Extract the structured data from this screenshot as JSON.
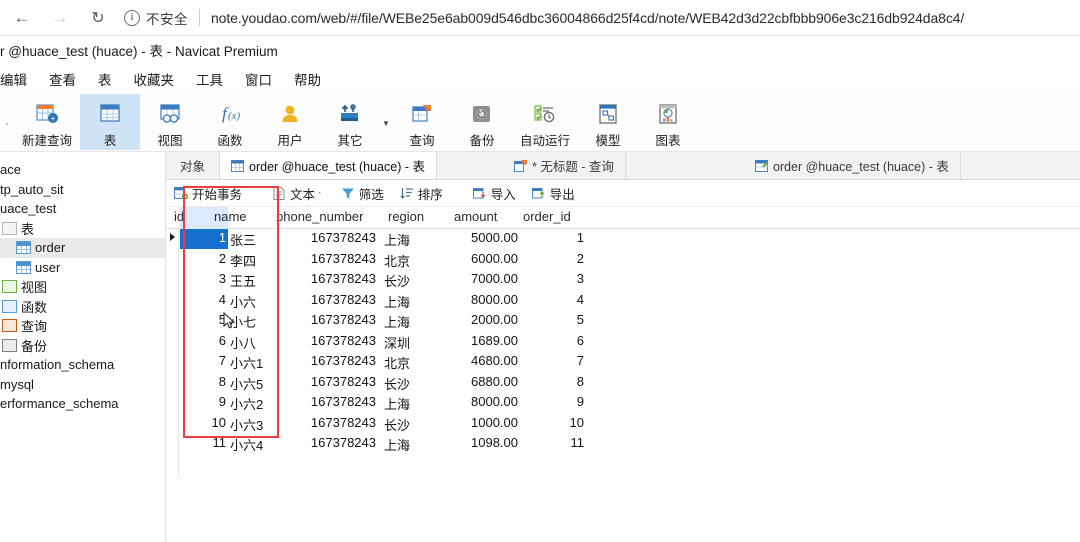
{
  "browser": {
    "back_icon": "back-arrow-icon",
    "forward_icon": "forward-arrow-icon",
    "reload_icon": "reload-icon",
    "info_icon": "info-circle-icon",
    "security_label": "不安全",
    "url": "note.youdao.com/web/#/file/WEBe25e6ab009d546dbc36004866d25f4cd/note/WEB42d3d22cbfbbb906e3c216db924da8c4/"
  },
  "app": {
    "title": "r @huace_test (huace) - 表 - Navicat Premium",
    "menu": [
      {
        "label": "编辑"
      },
      {
        "label": "查看"
      },
      {
        "label": "表"
      },
      {
        "label": "收藏夹"
      },
      {
        "label": "工具"
      },
      {
        "label": "窗口"
      },
      {
        "label": "帮助"
      }
    ],
    "ribbon": [
      {
        "label": "新建查询",
        "icon": "new-query-icon",
        "active": false
      },
      {
        "label": "表",
        "icon": "table-icon",
        "active": true
      },
      {
        "label": "视图",
        "icon": "view-icon",
        "active": false
      },
      {
        "label": "函数",
        "icon": "function-icon",
        "active": false
      },
      {
        "label": "用户",
        "icon": "user-icon",
        "active": false
      },
      {
        "label": "其它",
        "icon": "other-tools-icon",
        "active": false
      },
      {
        "label": "查询",
        "icon": "query-icon",
        "active": false
      },
      {
        "label": "备份",
        "icon": "backup-icon",
        "active": false
      },
      {
        "label": "自动运行",
        "icon": "automation-icon",
        "active": false
      },
      {
        "label": "模型",
        "icon": "model-icon",
        "active": false
      },
      {
        "label": "图表",
        "icon": "chart-icon",
        "active": false
      }
    ]
  },
  "sidebar": {
    "items": [
      {
        "label": "ace",
        "icon": "connection-icon",
        "indent": 0,
        "selected": false
      },
      {
        "label": "tp_auto_sit",
        "icon": "database-icon",
        "indent": 0,
        "selected": false
      },
      {
        "label": "uace_test",
        "icon": "database-icon",
        "indent": 0,
        "selected": false
      },
      {
        "label": "表",
        "icon": "folder-icon",
        "indent": 1,
        "selected": false
      },
      {
        "label": "order",
        "icon": "table-icon",
        "indent": 2,
        "selected": true
      },
      {
        "label": "user",
        "icon": "table-icon",
        "indent": 2,
        "selected": false
      },
      {
        "label": "视图",
        "icon": "view-folder-icon",
        "indent": 1,
        "selected": false
      },
      {
        "label": "函数",
        "icon": "function-folder-icon",
        "indent": 1,
        "selected": false
      },
      {
        "label": "查询",
        "icon": "query-folder-icon",
        "indent": 1,
        "selected": false
      },
      {
        "label": "备份",
        "icon": "backup-folder-icon",
        "indent": 1,
        "selected": false
      },
      {
        "label": "nformation_schema",
        "icon": "database-icon",
        "indent": 0,
        "selected": false
      },
      {
        "label": "mysql",
        "icon": "database-icon",
        "indent": 0,
        "selected": false
      },
      {
        "label": "erformance_schema",
        "icon": "database-icon",
        "indent": 0,
        "selected": false
      }
    ]
  },
  "tabs": [
    {
      "label": "对象",
      "icon": "",
      "active": false
    },
    {
      "label": "order @huace_test (huace) - 表",
      "icon": "table-tab-icon",
      "active": true
    },
    {
      "label": "* 无标题 - 查询",
      "icon": "query-tab-icon",
      "active": false
    },
    {
      "label": "order @huace_test (huace) - 表",
      "icon": "table-design-tab-icon",
      "active": false
    }
  ],
  "actions": [
    {
      "label": "开始事务",
      "icon": "transaction-icon",
      "caret": false
    },
    {
      "label": "文本",
      "icon": "text-icon",
      "caret": true
    },
    {
      "label": "筛选",
      "icon": "filter-icon",
      "caret": false
    },
    {
      "label": "排序",
      "icon": "sort-icon",
      "caret": false
    },
    {
      "label": "导入",
      "icon": "import-icon",
      "caret": false
    },
    {
      "label": "导出",
      "icon": "export-icon",
      "caret": false
    }
  ],
  "grid": {
    "columns": [
      "id",
      "name",
      "phone_number",
      "region",
      "amount",
      "order_id"
    ],
    "selected_cell": {
      "row": 0,
      "column": "id"
    },
    "rows": [
      {
        "id": "1",
        "name": "张三",
        "phone_number": "167378243",
        "region": "上海",
        "amount": "5000.00",
        "order_id": "1"
      },
      {
        "id": "2",
        "name": "李四",
        "phone_number": "167378243",
        "region": "北京",
        "amount": "6000.00",
        "order_id": "2"
      },
      {
        "id": "3",
        "name": "王五",
        "phone_number": "167378243",
        "region": "长沙",
        "amount": "7000.00",
        "order_id": "3"
      },
      {
        "id": "4",
        "name": "小六",
        "phone_number": "167378243",
        "region": "上海",
        "amount": "8000.00",
        "order_id": "4"
      },
      {
        "id": "5",
        "name": "小七",
        "phone_number": "167378243",
        "region": "上海",
        "amount": "2000.00",
        "order_id": "5"
      },
      {
        "id": "6",
        "name": "小八",
        "phone_number": "167378243",
        "region": "深圳",
        "amount": "1689.00",
        "order_id": "6"
      },
      {
        "id": "7",
        "name": "小六1",
        "phone_number": "167378243",
        "region": "北京",
        "amount": "4680.00",
        "order_id": "7"
      },
      {
        "id": "8",
        "name": "小六5",
        "phone_number": "167378243",
        "region": "长沙",
        "amount": "6880.00",
        "order_id": "8"
      },
      {
        "id": "9",
        "name": "小六2",
        "phone_number": "167378243",
        "region": "上海",
        "amount": "8000.00",
        "order_id": "9"
      },
      {
        "id": "10",
        "name": "小六3",
        "phone_number": "167378243",
        "region": "长沙",
        "amount": "1000.00",
        "order_id": "10"
      },
      {
        "id": "11",
        "name": "小六4",
        "phone_number": "167378243",
        "region": "上海",
        "amount": "1098.00",
        "order_id": "11"
      }
    ]
  },
  "annotation": {
    "color": "#f23b3b",
    "label": "name-column-highlight"
  },
  "colors": {
    "selection_blue": "#1570cd",
    "ribbon_active": "#cfe4f7",
    "annotation_red": "#f23b3b"
  }
}
